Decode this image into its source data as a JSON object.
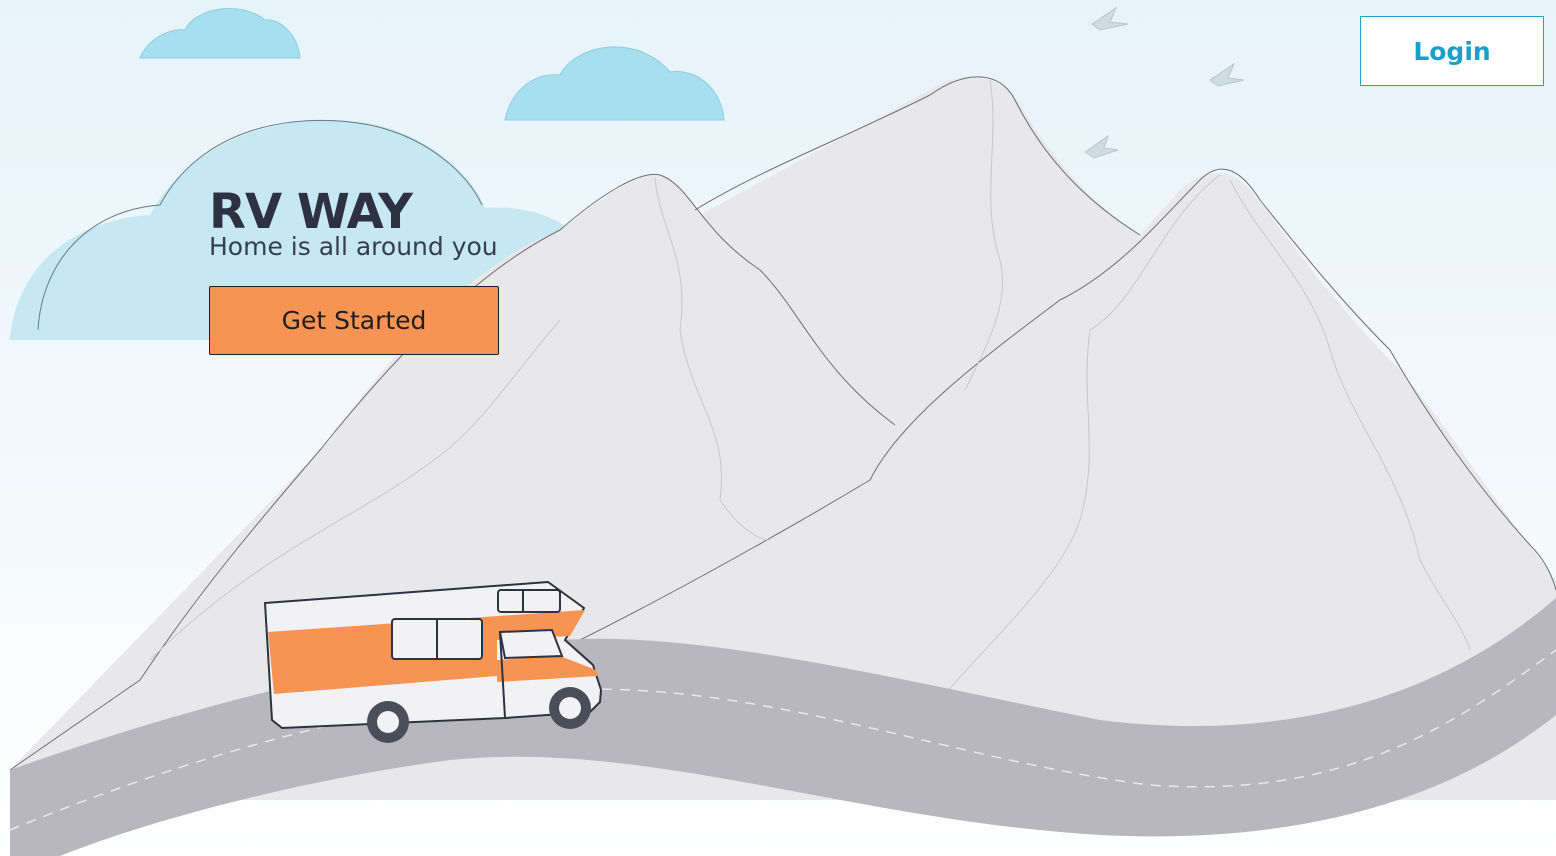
{
  "header": {
    "login_label": "Login"
  },
  "hero": {
    "title": "RV WAY",
    "tagline": "Home is all around you",
    "cta_label": "Get Started"
  },
  "colors": {
    "accent_orange": "#f79454",
    "login_blue": "#1a9fc7",
    "cloud": "#a8dfee",
    "mountain": "#e8e8ea",
    "road": "#b7b7bd",
    "title_dark": "#2e3141"
  },
  "icons": [
    "cloud-illustration",
    "bird-icon",
    "mountain-illustration",
    "road-illustration",
    "rv-camper-illustration"
  ]
}
